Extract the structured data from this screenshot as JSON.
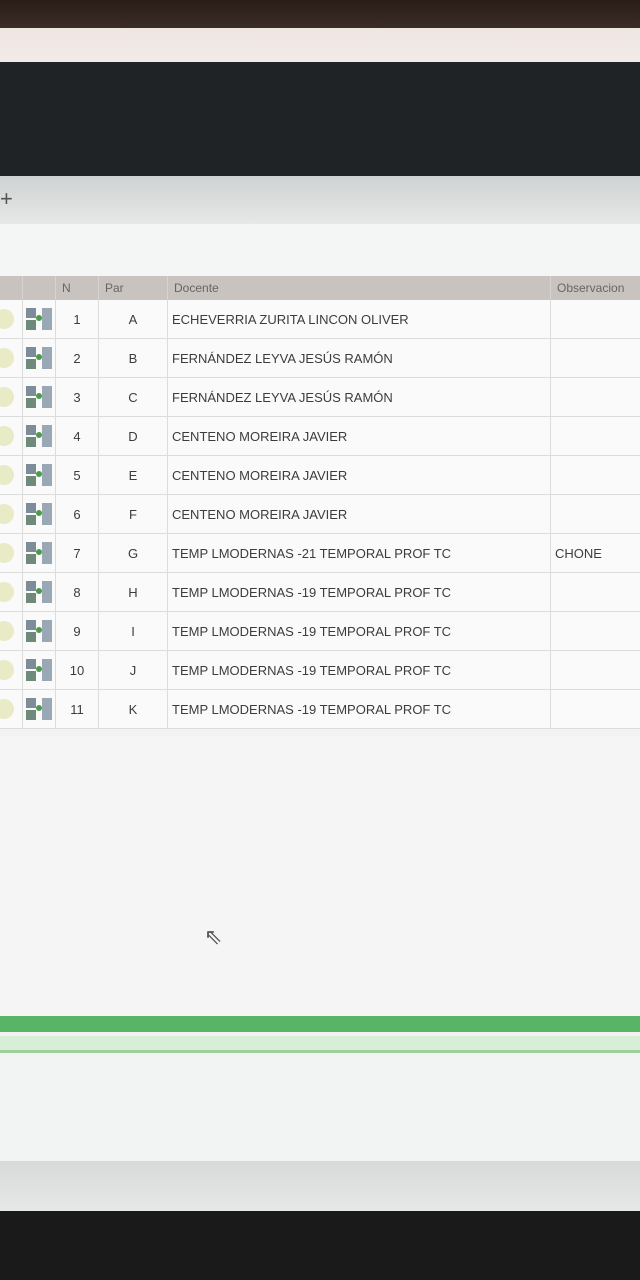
{
  "grid": {
    "headers": [
      "N",
      "Par",
      "Docente",
      "Observacion"
    ],
    "rows": [
      {
        "n": "1",
        "par": "A",
        "docente": "ECHEVERRIA ZURITA LINCON OLIVER",
        "obs": ""
      },
      {
        "n": "2",
        "par": "B",
        "docente": "FERNÁNDEZ LEYVA JESÚS RAMÓN",
        "obs": ""
      },
      {
        "n": "3",
        "par": "C",
        "docente": "FERNÁNDEZ LEYVA JESÚS RAMÓN",
        "obs": ""
      },
      {
        "n": "4",
        "par": "D",
        "docente": "CENTENO MOREIRA JAVIER",
        "obs": ""
      },
      {
        "n": "5",
        "par": "E",
        "docente": "CENTENO MOREIRA JAVIER",
        "obs": ""
      },
      {
        "n": "6",
        "par": "F",
        "docente": "CENTENO MOREIRA JAVIER",
        "obs": ""
      },
      {
        "n": "7",
        "par": "G",
        "docente": "TEMP LMODERNAS -21 TEMPORAL PROF TC",
        "obs": "CHONE"
      },
      {
        "n": "8",
        "par": "H",
        "docente": "TEMP LMODERNAS -19 TEMPORAL PROF TC",
        "obs": ""
      },
      {
        "n": "9",
        "par": "I",
        "docente": "TEMP LMODERNAS -19 TEMPORAL PROF TC",
        "obs": ""
      },
      {
        "n": "10",
        "par": "J",
        "docente": "TEMP LMODERNAS -19 TEMPORAL PROF TC",
        "obs": ""
      },
      {
        "n": "11",
        "par": "K",
        "docente": "TEMP LMODERNAS -19 TEMPORAL PROF TC",
        "obs": ""
      }
    ]
  },
  "toolbar": {
    "add_glyph": "+"
  },
  "icons": {
    "row_status": "status-circle-icon",
    "row_action": "edit-grid-icon",
    "cursor": "mouse-pointer-icon"
  }
}
